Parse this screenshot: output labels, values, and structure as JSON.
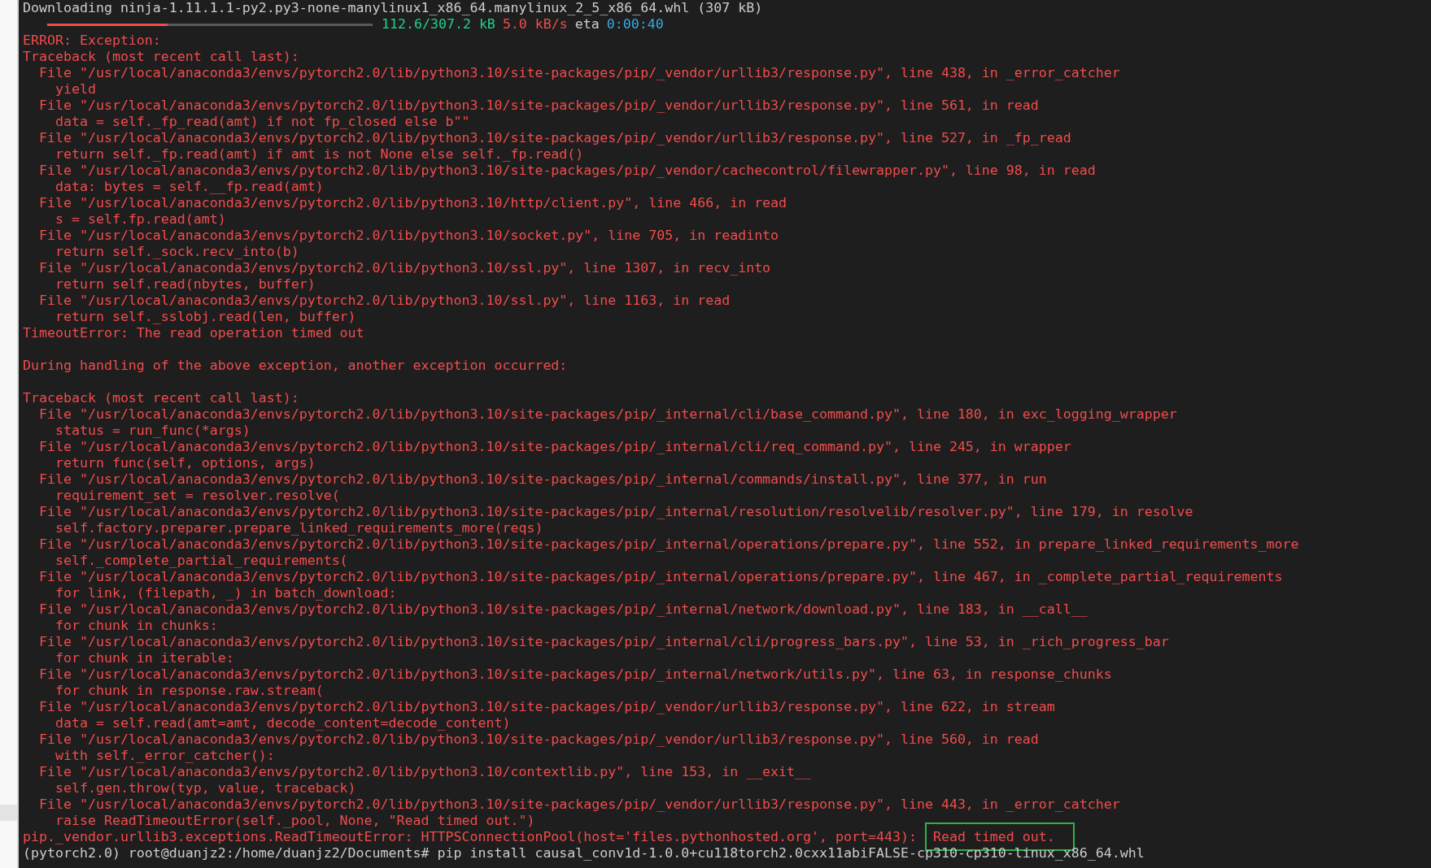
{
  "terminal": {
    "lines": [
      {
        "kind": "plain",
        "text": "Downloading ninja-1.11.1.1-py2.py3-none-manylinux1_x86_64.manylinux_2_5_x86_64.whl (307 kB)"
      },
      {
        "kind": "progress",
        "level": 0.37,
        "size": "112.6/307.2 kB",
        "speed": "5.0 kB/s",
        "eta_label": "eta",
        "eta": "0:00:40"
      },
      {
        "kind": "error",
        "text": "ERROR: Exception:"
      },
      {
        "kind": "error",
        "text": "Traceback (most recent call last):"
      },
      {
        "kind": "error",
        "text": "  File \"/usr/local/anaconda3/envs/pytorch2.0/lib/python3.10/site-packages/pip/_vendor/urllib3/response.py\", line 438, in _error_catcher"
      },
      {
        "kind": "error",
        "text": "    yield"
      },
      {
        "kind": "error",
        "text": "  File \"/usr/local/anaconda3/envs/pytorch2.0/lib/python3.10/site-packages/pip/_vendor/urllib3/response.py\", line 561, in read"
      },
      {
        "kind": "error",
        "text": "    data = self._fp_read(amt) if not fp_closed else b\"\""
      },
      {
        "kind": "error",
        "text": "  File \"/usr/local/anaconda3/envs/pytorch2.0/lib/python3.10/site-packages/pip/_vendor/urllib3/response.py\", line 527, in _fp_read"
      },
      {
        "kind": "error",
        "text": "    return self._fp.read(amt) if amt is not None else self._fp.read()"
      },
      {
        "kind": "error",
        "text": "  File \"/usr/local/anaconda3/envs/pytorch2.0/lib/python3.10/site-packages/pip/_vendor/cachecontrol/filewrapper.py\", line 98, in read"
      },
      {
        "kind": "error",
        "text": "    data: bytes = self.__fp.read(amt)"
      },
      {
        "kind": "error",
        "text": "  File \"/usr/local/anaconda3/envs/pytorch2.0/lib/python3.10/http/client.py\", line 466, in read"
      },
      {
        "kind": "error",
        "text": "    s = self.fp.read(amt)"
      },
      {
        "kind": "error",
        "text": "  File \"/usr/local/anaconda3/envs/pytorch2.0/lib/python3.10/socket.py\", line 705, in readinto"
      },
      {
        "kind": "error",
        "text": "    return self._sock.recv_into(b)"
      },
      {
        "kind": "error",
        "text": "  File \"/usr/local/anaconda3/envs/pytorch2.0/lib/python3.10/ssl.py\", line 1307, in recv_into"
      },
      {
        "kind": "error",
        "text": "    return self.read(nbytes, buffer)"
      },
      {
        "kind": "error",
        "text": "  File \"/usr/local/anaconda3/envs/pytorch2.0/lib/python3.10/ssl.py\", line 1163, in read"
      },
      {
        "kind": "error",
        "text": "    return self._sslobj.read(len, buffer)"
      },
      {
        "kind": "error",
        "text": "TimeoutError: The read operation timed out"
      },
      {
        "kind": "blank"
      },
      {
        "kind": "error",
        "text": "During handling of the above exception, another exception occurred:"
      },
      {
        "kind": "blank"
      },
      {
        "kind": "error",
        "text": "Traceback (most recent call last):"
      },
      {
        "kind": "error",
        "text": "  File \"/usr/local/anaconda3/envs/pytorch2.0/lib/python3.10/site-packages/pip/_internal/cli/base_command.py\", line 180, in exc_logging_wrapper"
      },
      {
        "kind": "error",
        "text": "    status = run_func(*args)"
      },
      {
        "kind": "error",
        "text": "  File \"/usr/local/anaconda3/envs/pytorch2.0/lib/python3.10/site-packages/pip/_internal/cli/req_command.py\", line 245, in wrapper"
      },
      {
        "kind": "error",
        "text": "    return func(self, options, args)"
      },
      {
        "kind": "error",
        "text": "  File \"/usr/local/anaconda3/envs/pytorch2.0/lib/python3.10/site-packages/pip/_internal/commands/install.py\", line 377, in run"
      },
      {
        "kind": "error",
        "text": "    requirement_set = resolver.resolve("
      },
      {
        "kind": "error",
        "text": "  File \"/usr/local/anaconda3/envs/pytorch2.0/lib/python3.10/site-packages/pip/_internal/resolution/resolvelib/resolver.py\", line 179, in resolve"
      },
      {
        "kind": "error",
        "text": "    self.factory.preparer.prepare_linked_requirements_more(reqs)"
      },
      {
        "kind": "error",
        "text": "  File \"/usr/local/anaconda3/envs/pytorch2.0/lib/python3.10/site-packages/pip/_internal/operations/prepare.py\", line 552, in prepare_linked_requirements_more"
      },
      {
        "kind": "error",
        "text": "    self._complete_partial_requirements("
      },
      {
        "kind": "error",
        "text": "  File \"/usr/local/anaconda3/envs/pytorch2.0/lib/python3.10/site-packages/pip/_internal/operations/prepare.py\", line 467, in _complete_partial_requirements"
      },
      {
        "kind": "error",
        "text": "    for link, (filepath, _) in batch_download:"
      },
      {
        "kind": "error",
        "text": "  File \"/usr/local/anaconda3/envs/pytorch2.0/lib/python3.10/site-packages/pip/_internal/network/download.py\", line 183, in __call__"
      },
      {
        "kind": "error",
        "text": "    for chunk in chunks:"
      },
      {
        "kind": "error",
        "text": "  File \"/usr/local/anaconda3/envs/pytorch2.0/lib/python3.10/site-packages/pip/_internal/cli/progress_bars.py\", line 53, in _rich_progress_bar"
      },
      {
        "kind": "error",
        "text": "    for chunk in iterable:"
      },
      {
        "kind": "error",
        "text": "  File \"/usr/local/anaconda3/envs/pytorch2.0/lib/python3.10/site-packages/pip/_internal/network/utils.py\", line 63, in response_chunks"
      },
      {
        "kind": "error",
        "text": "    for chunk in response.raw.stream("
      },
      {
        "kind": "error",
        "text": "  File \"/usr/local/anaconda3/envs/pytorch2.0/lib/python3.10/site-packages/pip/_vendor/urllib3/response.py\", line 622, in stream"
      },
      {
        "kind": "error",
        "text": "    data = self.read(amt=amt, decode_content=decode_content)"
      },
      {
        "kind": "error",
        "text": "  File \"/usr/local/anaconda3/envs/pytorch2.0/lib/python3.10/site-packages/pip/_vendor/urllib3/response.py\", line 560, in read"
      },
      {
        "kind": "error",
        "text": "    with self._error_catcher():"
      },
      {
        "kind": "error",
        "text": "  File \"/usr/local/anaconda3/envs/pytorch2.0/lib/python3.10/contextlib.py\", line 153, in __exit__"
      },
      {
        "kind": "error",
        "text": "    self.gen.throw(typ, value, traceback)"
      },
      {
        "kind": "error",
        "text": "  File \"/usr/local/anaconda3/envs/pytorch2.0/lib/python3.10/site-packages/pip/_vendor/urllib3/response.py\", line 443, in _error_catcher"
      },
      {
        "kind": "error",
        "text": "    raise ReadTimeoutError(self._pool, None, \"Read timed out.\")"
      },
      {
        "kind": "error",
        "text": "pip._vendor.urllib3.exceptions.ReadTimeoutError: HTTPSConnectionPool(host='files.pythonhosted.org', port=443):",
        "boxed": "Read timed out."
      },
      {
        "kind": "plain",
        "text": "(pytorch2.0) root@duanjz2:/home/duanjz2/Documents# pip install causal_conv1d-1.0.0+cu118torch2.0cxx11abiFALSE-cp310-cp310-linux_x86_64.whl"
      }
    ]
  }
}
